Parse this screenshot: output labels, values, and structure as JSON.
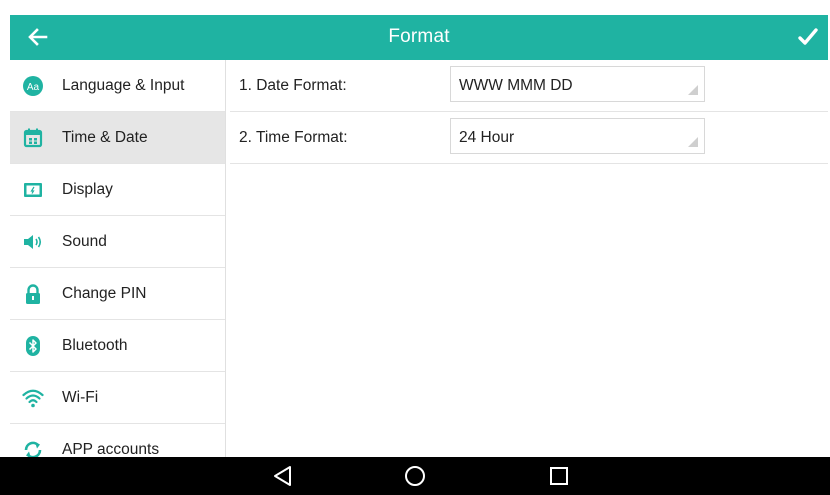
{
  "header": {
    "title": "Format"
  },
  "sidebar": {
    "items": [
      {
        "label": "Language & Input",
        "icon": "language-icon"
      },
      {
        "label": "Time & Date",
        "icon": "calendar-icon"
      },
      {
        "label": "Display",
        "icon": "display-icon"
      },
      {
        "label": "Sound",
        "icon": "speaker-icon"
      },
      {
        "label": "Change PIN",
        "icon": "lock-icon"
      },
      {
        "label": "Bluetooth",
        "icon": "bluetooth-icon"
      },
      {
        "label": "Wi-Fi",
        "icon": "wifi-icon"
      },
      {
        "label": "APP accounts",
        "icon": "sync-icon"
      }
    ],
    "selected_index": 1
  },
  "settings": {
    "rows": [
      {
        "label": "1. Date Format:",
        "value": "WWW MMM DD"
      },
      {
        "label": "2. Time Format:",
        "value": "24 Hour"
      }
    ]
  },
  "colors": {
    "accent": "#1fb3a2",
    "selected_row": "#e6e6e6",
    "nav_bar": "#000000"
  },
  "navbar": {
    "buttons": [
      "back-triangle-icon",
      "home-circle-icon",
      "recents-square-icon"
    ]
  }
}
